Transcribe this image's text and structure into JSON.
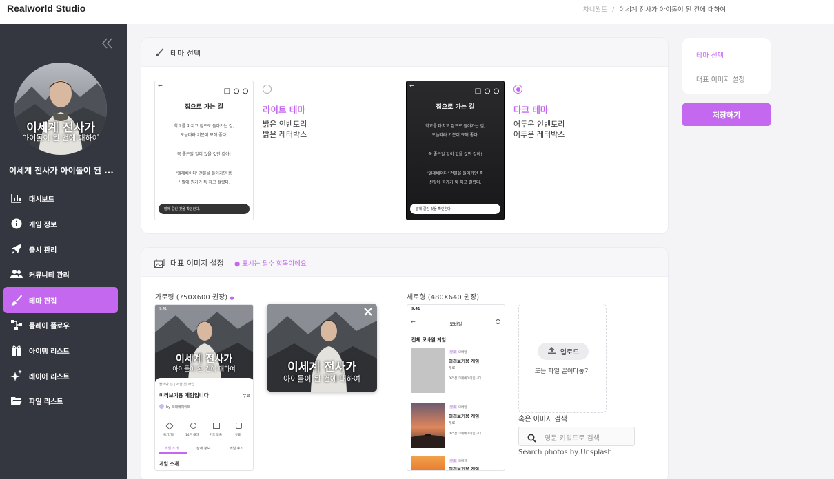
{
  "app": {
    "brand": "Realworld Studio"
  },
  "breadcrumb": {
    "parent": "차니월드",
    "sep": "/",
    "current": "이세계 전사가 아이돌이 된 건에 대하여"
  },
  "sidebar": {
    "collapse_icon": "double-chevron-left-icon",
    "cover_text_main": "이세계 전사가",
    "cover_text_sub": "아이돌이 된 건에 대하여",
    "game_name": "이세계 전사가 아이돌이 된 ...",
    "items": [
      {
        "label": "대시보드",
        "icon": "bar-chart-icon",
        "active": false
      },
      {
        "label": "게임 정보",
        "icon": "info-icon",
        "active": false
      },
      {
        "label": "출시 관리",
        "icon": "rocket-icon",
        "active": false
      },
      {
        "label": "커뮤니티 관리",
        "icon": "users-icon",
        "active": false
      },
      {
        "label": "테마 편집",
        "icon": "brush-icon",
        "active": true
      },
      {
        "label": "플레이 플로우",
        "icon": "flow-icon",
        "active": false
      },
      {
        "label": "아이템 리스트",
        "icon": "gift-icon",
        "active": false
      },
      {
        "label": "레이어 리스트",
        "icon": "sparkle-icon",
        "active": false
      },
      {
        "label": "파일 리스트",
        "icon": "folder-icon",
        "active": false
      }
    ]
  },
  "theme_panel": {
    "title": "테마 선택",
    "preview": {
      "title": "집으로 가는 길",
      "lines": [
        "학교를 마치고 집으로 돌아가는 길,",
        "오늘따라 기분이 묘해 좋다.",
        "꼭 좋은일 일이 있을 것만 같아!",
        "'엘레베이터' 건물을 들어가던 중",
        "신발에 뭔가가 툭 하고 걸렸다."
      ],
      "input": "발에 걸린 것을 확인한다."
    },
    "light": {
      "name": "라이트 테마",
      "desc1": "밝은 인벤토리",
      "desc2": "밝은 레터박스",
      "selected": false
    },
    "dark": {
      "name": "다크 테마",
      "desc1": "어두운 인벤토리",
      "desc2": "어두운 레터박스",
      "selected": true
    }
  },
  "image_panel": {
    "title": "대표 이미지 설정",
    "required_note": "● 표시는 필수 항목이에요",
    "landscape_label": "가로형 (750X600 권장)",
    "landscape_dot": "●",
    "portrait_label": "세로형 (480X640 권장)",
    "cover_text_main": "이세계 전사가",
    "cover_text_sub": "아이돌이 된 건에 대하여",
    "mock_land": {
      "time": "9:41",
      "tags": "블랙박 ◎ | 서울 첫 작업",
      "title": "미리보기용 게임입니다",
      "badge": "무료",
      "author": "by 크레에이이트",
      "actions": [
        "즐기기용",
        "14만 내려",
        "카드 또출",
        "유료"
      ],
      "tabs": [
        "게임 소개",
        "상세 정보",
        "게임 후기"
      ],
      "section": "게임 소개"
    },
    "mock_port": {
      "time": "9:41",
      "header": "모바일",
      "section": "전체 모바일 게임",
      "items": [
        {
          "tag": "무료",
          "sub": "모바일",
          "title": "미리보기용 게임",
          "badge": "무료",
          "desc": "여러분 크레에이미입니다."
        },
        {
          "tag": "무료",
          "sub": "모바일",
          "title": "미리보기용 게임",
          "badge": "무료",
          "desc": "여러분 크레에이미입니다."
        },
        {
          "tag": "무료",
          "sub": "모바일",
          "title": "미리보기용 게임",
          "badge": "",
          "desc": ""
        }
      ]
    },
    "upload_label": "업로드",
    "drop_text": "또는 파일 끌어다놓기",
    "search_label": "혹은 이미지 검색",
    "search_placeholder": "영문 키워드로 검색",
    "unsplash_note": "Search photos by Unsplash"
  },
  "right_nav": {
    "items": [
      "테마 선택",
      "대표 이미지 설정"
    ]
  },
  "save_label": "저장하기",
  "colors": {
    "accent": "#c368ef",
    "sidebar": "#343640"
  }
}
